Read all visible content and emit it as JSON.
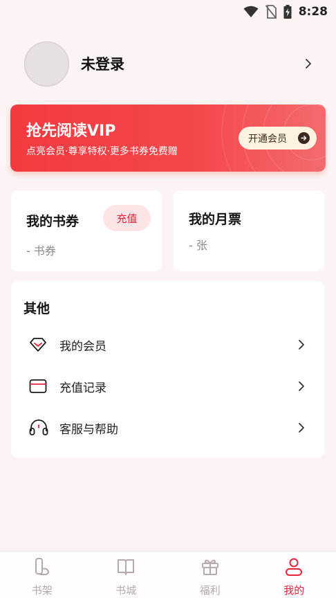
{
  "status_bar": {
    "time": "8:28"
  },
  "profile": {
    "name": "未登录"
  },
  "vip_banner": {
    "title": "抢先阅读VIP",
    "subtitle": "点亮会员·尊享特权·更多书券免费赠",
    "button_label": "开通会员"
  },
  "coupon_card": {
    "title": "我的书券",
    "value": "- 书券",
    "recharge_label": "充值"
  },
  "ticket_card": {
    "title": "我的月票",
    "value": "- 张"
  },
  "others": {
    "title": "其他",
    "items": [
      {
        "label": "我的会员",
        "icon": "diamond-icon"
      },
      {
        "label": "充值记录",
        "icon": "card-icon"
      },
      {
        "label": "客服与帮助",
        "icon": "headset-icon"
      }
    ]
  },
  "bottom_nav": {
    "items": [
      {
        "label": "书架",
        "icon": "bookshelf-icon",
        "active": false
      },
      {
        "label": "书城",
        "icon": "book-icon",
        "active": false
      },
      {
        "label": "福利",
        "icon": "gift-icon",
        "active": false
      },
      {
        "label": "我的",
        "icon": "user-icon",
        "active": true
      }
    ]
  },
  "colors": {
    "accent": "#e8233a",
    "banner": "#f33a3f",
    "background": "#fbf4f3"
  }
}
